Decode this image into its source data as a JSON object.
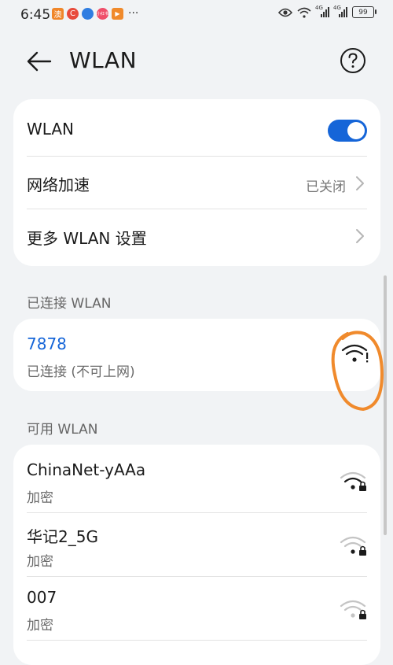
{
  "status_bar": {
    "time": "6:45",
    "notif_badges": [
      {
        "name": "app-icon-orange",
        "color": "#f0862a",
        "glyph": "澳"
      },
      {
        "name": "app-icon-red",
        "color": "#e84a3b",
        "glyph": "C"
      },
      {
        "name": "app-icon-blue",
        "color": "#2f7de1",
        "glyph": ""
      },
      {
        "name": "app-icon-pink",
        "color": "#ef4e6a",
        "glyph": "小红书"
      },
      {
        "name": "app-icon-video",
        "color": "#f08a2c",
        "glyph": "▶"
      }
    ],
    "more": "···",
    "signal1_label": "4G",
    "signal2_label": "4G",
    "battery": "99"
  },
  "header": {
    "title": "WLAN"
  },
  "settings": {
    "wlan_label": "WLAN",
    "wlan_enabled": true,
    "accel_label": "网络加速",
    "accel_value": "已关闭",
    "more_label": "更多 WLAN 设置"
  },
  "connected_section": {
    "title": "已连接 WLAN",
    "network": {
      "name": "7878",
      "status": "已连接 (不可上网)"
    }
  },
  "available_section": {
    "title": "可用 WLAN",
    "networks": [
      {
        "name": "ChinaNet-yAAa",
        "security": "加密"
      },
      {
        "name": "华记2_5G",
        "security": "加密"
      },
      {
        "name": "007",
        "security": "加密"
      }
    ]
  },
  "colors": {
    "accent": "#1565d8",
    "annotation": "#f08a2c"
  }
}
